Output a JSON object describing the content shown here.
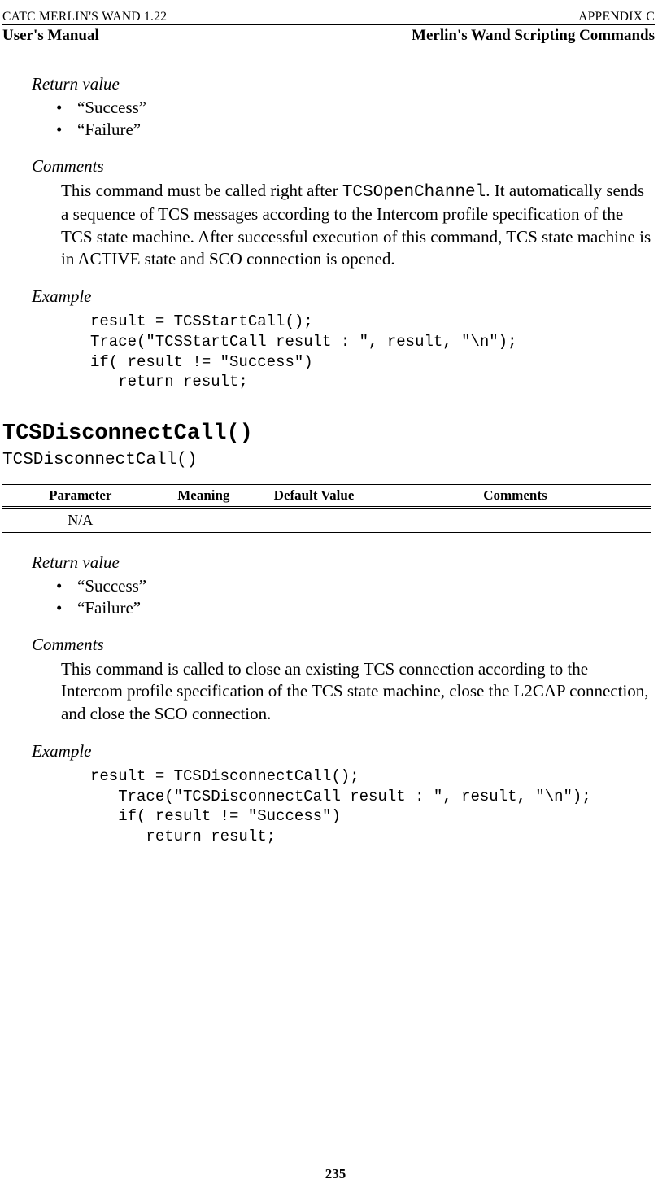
{
  "header": {
    "left_small": "CATC MERLIN'S WAND 1.22",
    "right_small": "APPENDIX C",
    "left_bold": "User's Manual",
    "right_bold": "Merlin's Wand Scripting Commands"
  },
  "section1": {
    "return_label": "Return value",
    "bullets": [
      "“Success”",
      "“Failure”"
    ],
    "comments_label": "Comments",
    "comments_pre": "This command must be called right after ",
    "comments_mono": "TCSOpenChannel",
    "comments_post": ". It automatically sends a sequence of TCS messages according to the Intercom profile specification of the TCS state machine. After successful execution of this command, TCS state machine is in ACTIVE state and SCO connection is opened.",
    "example_label": "Example",
    "code": "result = TCSStartCall();\nTrace(\"TCSStartCall result : \", result, \"\\n\");\nif( result != \"Success\")\n   return result;"
  },
  "func2": {
    "title": "TCSDisconnectCall()",
    "syntax": "TCSDisconnectCall()",
    "table": {
      "headers": [
        "Parameter",
        "Meaning",
        "Default Value",
        "Comments"
      ],
      "row": [
        "N/A",
        "",
        "",
        ""
      ]
    },
    "return_label": "Return value",
    "bullets": [
      "“Success”",
      "“Failure”"
    ],
    "comments_label": "Comments",
    "comments_text": "This command is called to close an existing TCS connection according to the Intercom profile specification of the TCS state machine, close the L2CAP connection, and close the SCO connection.",
    "example_label": "Example",
    "code": "result = TCSDisconnectCall();\n   Trace(\"TCSDisconnectCall result : \", result, \"\\n\");\n   if( result != \"Success\")\n      return result;"
  },
  "page_number": "235"
}
